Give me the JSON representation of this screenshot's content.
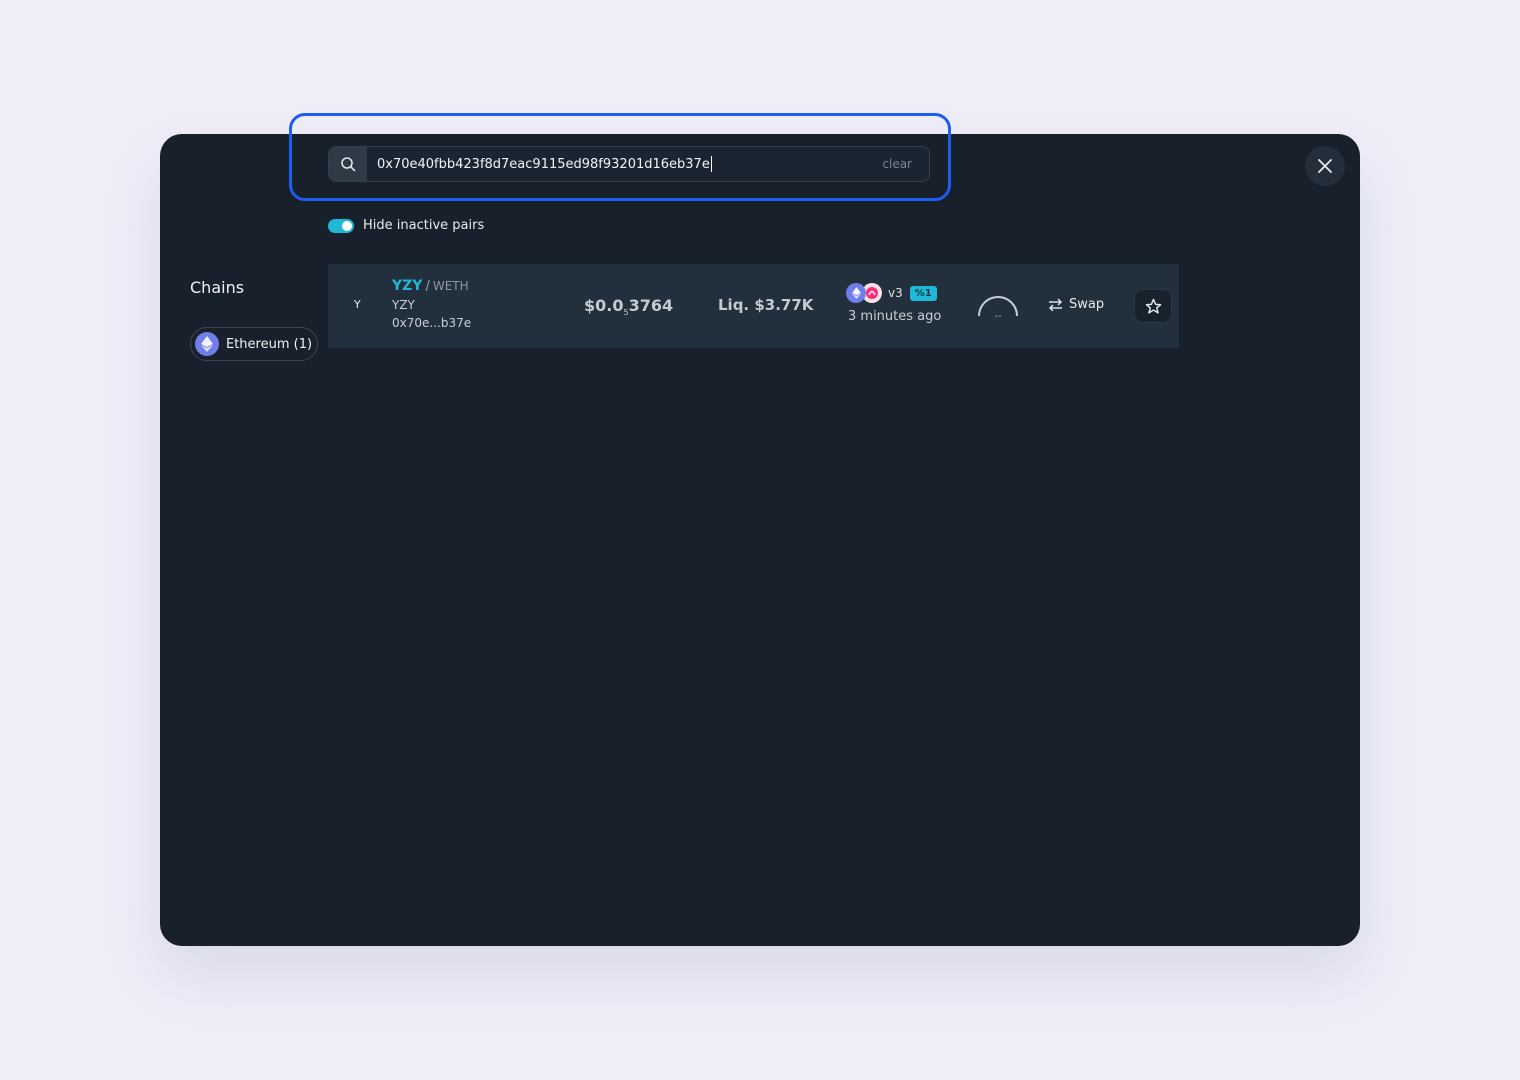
{
  "search": {
    "value": "0x70e40fbb423f8d7eac9115ed98f93201d16eb37e",
    "clear_label": "clear"
  },
  "filter": {
    "hide_inactive_label": "Hide inactive pairs",
    "hide_inactive_enabled": true
  },
  "chains": {
    "title": "Chains",
    "items": [
      {
        "label": "Ethereum (1)",
        "icon": "ethereum-icon"
      }
    ]
  },
  "results": [
    {
      "logo_text": "Y",
      "base_symbol": "YZY",
      "separator": "/",
      "quote_symbol": "WETH",
      "token_name": "YZY",
      "address": "0x70e...b37e",
      "price_prefix": "$0.0",
      "price_zeros": "5",
      "price_digits": "3764",
      "liquidity": "Liq. $3.77K",
      "dex_version": "v3",
      "fee_badge": "%1",
      "age": "3 minutes ago",
      "score": "--",
      "swap_label": "Swap"
    }
  ],
  "colors": {
    "accent": "#1fb8d6",
    "highlight": "#1f5cf0",
    "modal_bg": "#17202b",
    "row_bg": "#222f3c"
  }
}
